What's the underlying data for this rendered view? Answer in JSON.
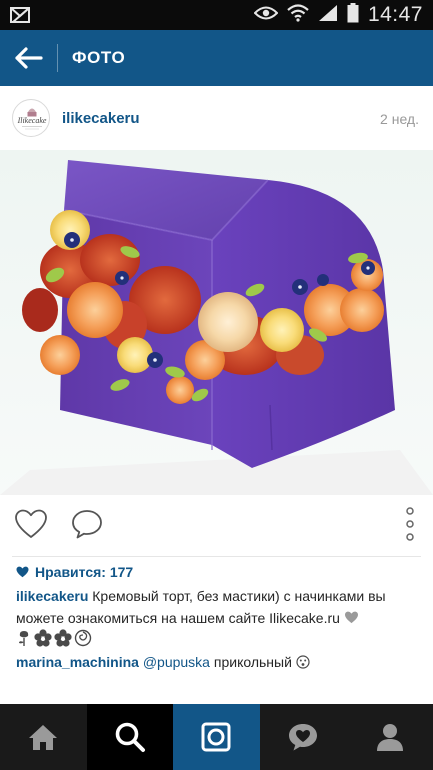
{
  "status_bar": {
    "time": "14:47",
    "icons": [
      "notification-icon",
      "eye-icon",
      "wifi-icon",
      "signal-icon",
      "battery-icon"
    ]
  },
  "action_bar": {
    "title": "ФОТО",
    "back_icon": "arrow-left-icon"
  },
  "post": {
    "username": "ilikecakeru",
    "avatar_text": "Ilikecake",
    "time": "2 нед.",
    "likes_label": "Нравится: 177",
    "caption": {
      "username": "ilikecakeru",
      "text": "Кремовый торт, без мастики) с начинками вы можете ознакомиться на нашем сайте Ilikecake.ru"
    },
    "caption_emoji": [
      "grey-heart",
      "rose",
      "flower",
      "flower",
      "rosette"
    ],
    "comments": [
      {
        "username": "marina_machinina",
        "mention": "@pupuska",
        "text": "прикольный"
      }
    ]
  },
  "actions": {
    "like_icon": "heart-outline-icon",
    "comment_icon": "comment-bubble-icon",
    "more_icon": "more-vertical-icon"
  },
  "bottom_nav": [
    "home-icon",
    "search-icon",
    "camera-icon",
    "activity-heart-icon",
    "profile-icon"
  ],
  "colors": {
    "brand": "#125688",
    "status_bar": "#0b0b0b",
    "nav_bar": "#1a1a1a",
    "text": "#262626",
    "muted": "#999999",
    "cake_purple": "#6a3fb3"
  }
}
